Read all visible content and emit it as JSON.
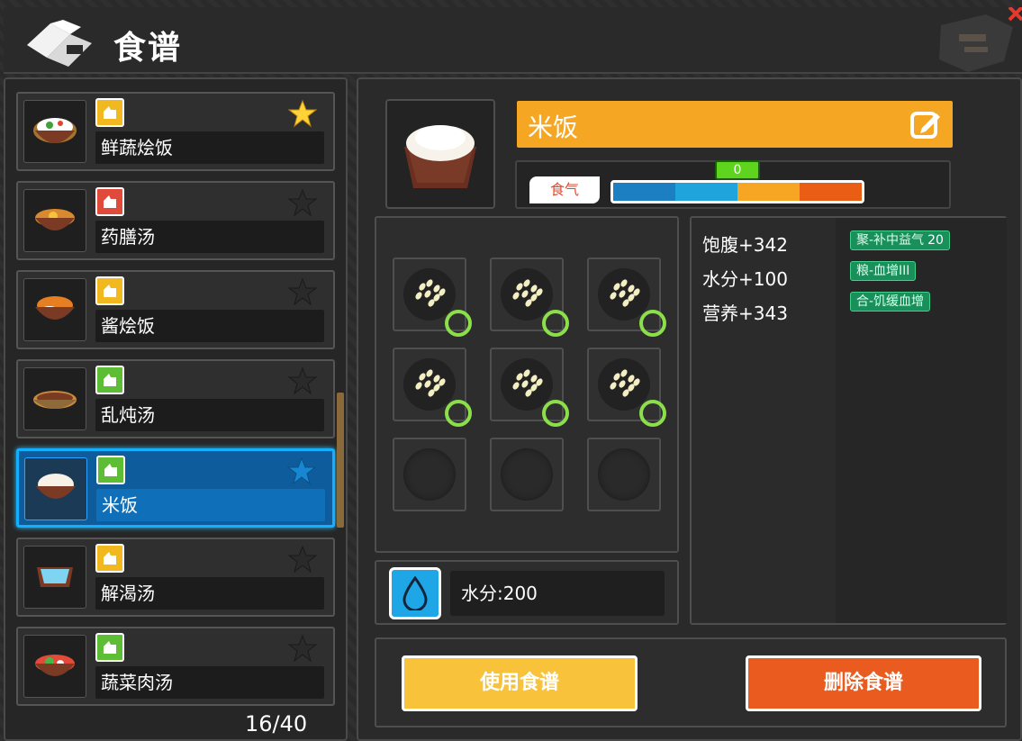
{
  "header": {
    "title": "食谱"
  },
  "recipes": [
    {
      "name": "鲜蔬烩饭",
      "badge": "yellow",
      "favorite": true
    },
    {
      "name": "药膳汤",
      "badge": "red",
      "favorite": false
    },
    {
      "name": "酱烩饭",
      "badge": "yellow",
      "favorite": false
    },
    {
      "name": "乱炖汤",
      "badge": "green",
      "favorite": false
    },
    {
      "name": "米饭",
      "badge": "green",
      "favorite": false,
      "selected": true
    },
    {
      "name": "解渴汤",
      "badge": "yellow",
      "favorite": false
    },
    {
      "name": "蔬菜肉汤",
      "badge": "green",
      "favorite": false
    }
  ],
  "page_count": "16/40",
  "detail": {
    "title": "米饭",
    "qi_label": "食气",
    "qi_value": "0",
    "water_label": "水分:200",
    "stats": [
      "饱腹+342",
      "水分+100",
      "营养+343"
    ],
    "tags": [
      {
        "text": "聚-补中益气",
        "num": "20"
      },
      {
        "text": "粮-血增III",
        "num": ""
      },
      {
        "text": "合-饥缓血增",
        "num": ""
      }
    ],
    "buttons": {
      "use": "使用食谱",
      "delete": "删除食谱"
    }
  },
  "colors": {
    "accent_orange": "#f5a623",
    "select_blue": "#12b0ff",
    "tag_green": "#198f5c"
  }
}
